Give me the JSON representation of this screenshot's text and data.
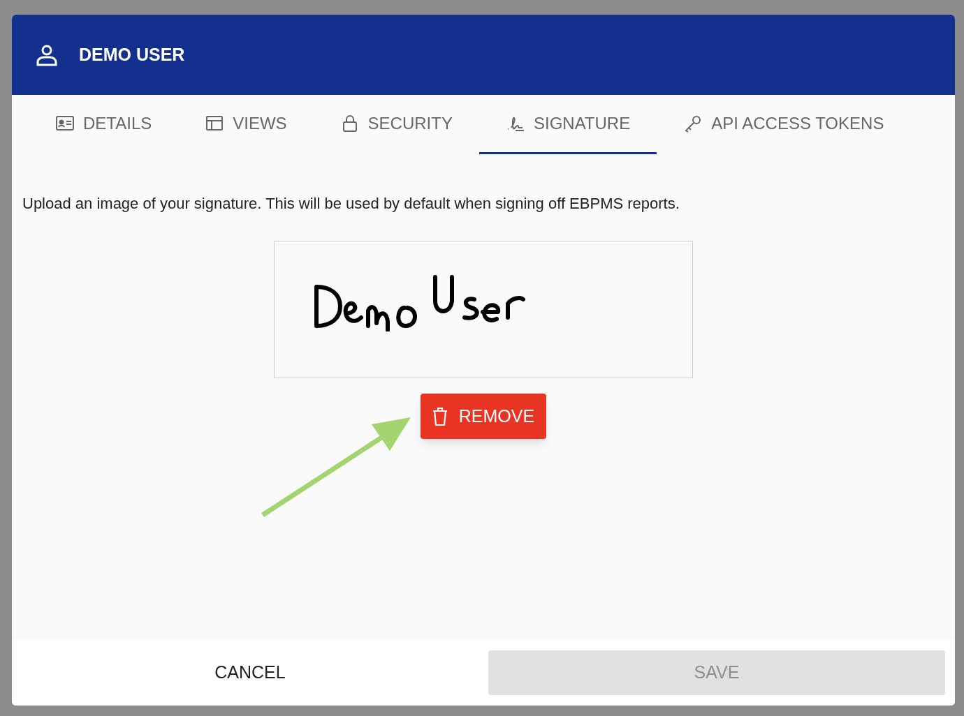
{
  "dialog": {
    "title": "DEMO USER",
    "tabs": [
      {
        "label": "DETAILS",
        "selected": false
      },
      {
        "label": "VIEWS",
        "selected": false
      },
      {
        "label": "SECURITY",
        "selected": false
      },
      {
        "label": "SIGNATURE",
        "selected": true
      },
      {
        "label": "API ACCESS TOKENS",
        "selected": false
      }
    ],
    "description": "Upload an image of your signature. This will be used by default when signing off EBPMS reports.",
    "remove_button": "REMOVE",
    "buttons": [
      {
        "label": "CANCEL",
        "disabled": false
      },
      {
        "label": "SAVE",
        "disabled": true
      }
    ]
  }
}
